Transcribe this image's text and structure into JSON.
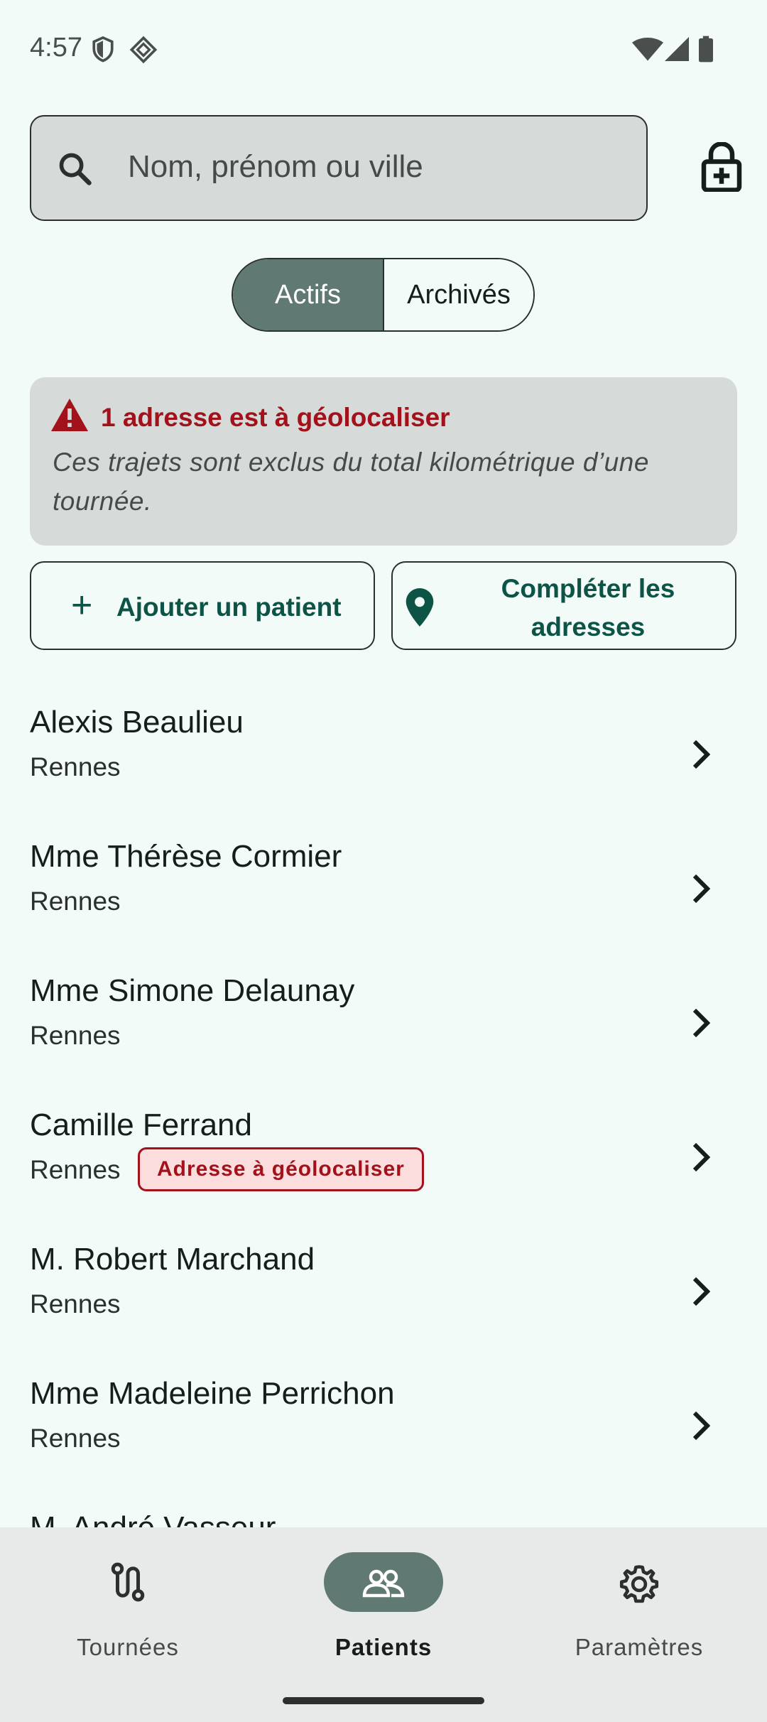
{
  "status_bar": {
    "time": "4:57",
    "icons_left": [
      "shield-icon",
      "diamond-icon"
    ],
    "icons_right": [
      "wifi-icon",
      "signal-icon",
      "battery-icon"
    ]
  },
  "search": {
    "placeholder": "Nom, prénom ou ville",
    "icon": "search-icon",
    "lock_icon": "lock-plus-icon"
  },
  "segmented": {
    "options": [
      "Actifs",
      "Archivés"
    ],
    "selected": "Actifs"
  },
  "alert": {
    "icon": "warning-icon",
    "title": "1 adresse est à géolocaliser",
    "body": "Ces trajets sont exclus du total kilométrique d’une tournée."
  },
  "actions": {
    "add_patient": "Ajouter un patient",
    "complete_addresses": "Compléter les adresses"
  },
  "patients": [
    {
      "name": "Alexis Beaulieu",
      "city": "Rennes",
      "badge": ""
    },
    {
      "name": "Mme Thérèse Cormier",
      "city": "Rennes",
      "badge": ""
    },
    {
      "name": "Mme Simone Delaunay",
      "city": "Rennes",
      "badge": ""
    },
    {
      "name": "Camille Ferrand",
      "city": "Rennes",
      "badge": "Adresse à géolocaliser"
    },
    {
      "name": "M. Robert Marchand",
      "city": "Rennes",
      "badge": ""
    },
    {
      "name": "Mme Madeleine Perrichon",
      "city": "Rennes",
      "badge": ""
    },
    {
      "name": "M. André Vasseur",
      "city": "",
      "badge": ""
    }
  ],
  "bottom_nav": {
    "items": [
      {
        "label": "Tournées",
        "icon": "route-icon"
      },
      {
        "label": "Patients",
        "icon": "people-icon"
      },
      {
        "label": "Paramètres",
        "icon": "gear-icon"
      }
    ],
    "selected": "Patients"
  },
  "colors": {
    "background": "#f3fbf8",
    "primary": "#607a73",
    "accent_text": "#0d5447",
    "error": "#a3111a",
    "surface_variant": "#d6dbd9"
  }
}
